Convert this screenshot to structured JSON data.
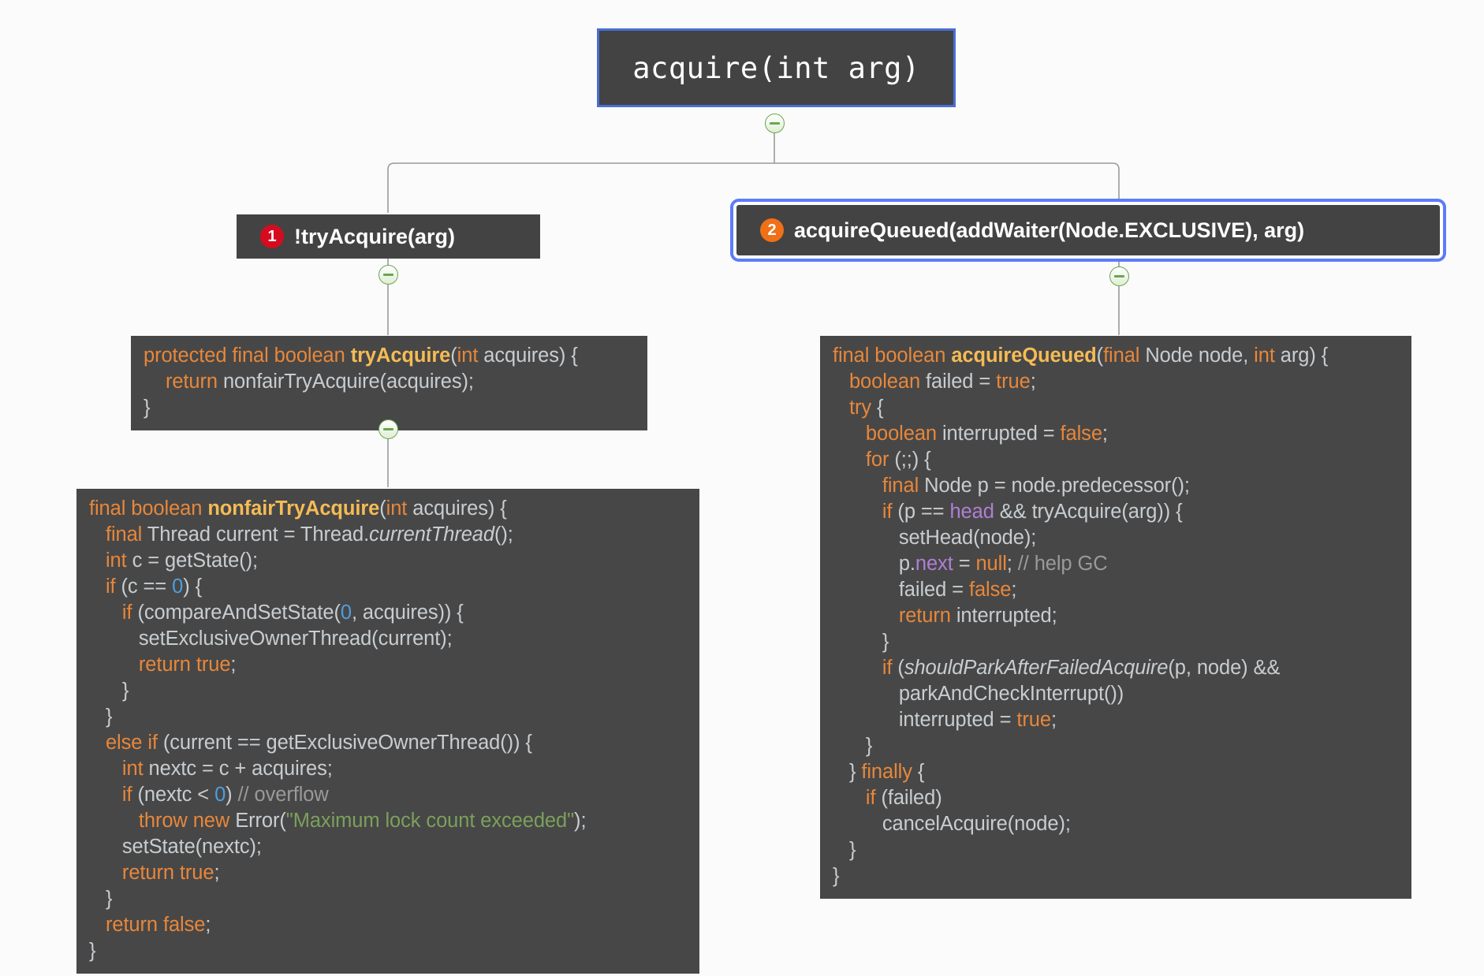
{
  "background_color": "#fbfbfb",
  "theme": {
    "node_bg": "#434343",
    "code_bg": "#474747",
    "selection_border": "#5b7cfa",
    "root_border": "#4a6fd4",
    "keyword_color": "#e8873a",
    "method_color": "#f5bb55",
    "number_color": "#4d9ede",
    "string_color": "#7ba05b",
    "comment_color": "#9a9a9a",
    "field_color": "#b07fd4",
    "badge_1_color": "#d50c1f",
    "badge_2_color": "#f07018",
    "toggle_color": "#6aa64f"
  },
  "root_node": {
    "label": "acquire(int arg)"
  },
  "branch_nodes": [
    {
      "badge": "1",
      "label": "!tryAcquire(arg)",
      "selected": false
    },
    {
      "badge": "2",
      "label": "acquireQueued(addWaiter(Node.EXCLUSIVE), arg)",
      "selected": true
    }
  ],
  "code_blocks": {
    "try_acquire": {
      "lines": [
        [
          {
            "t": "protected final boolean ",
            "c": "kw"
          },
          {
            "t": "tryAcquire",
            "c": "mth"
          },
          {
            "t": "(",
            "c": ""
          },
          {
            "t": "int",
            "c": "kw"
          },
          {
            "t": " acquires) {",
            "c": ""
          }
        ],
        [
          {
            "t": "    ",
            "c": ""
          },
          {
            "t": "return",
            "c": "kw"
          },
          {
            "t": " nonfairTryAcquire(acquires);",
            "c": ""
          }
        ],
        [
          {
            "t": "}",
            "c": ""
          }
        ]
      ],
      "plain_text": "protected final boolean tryAcquire(int acquires) {\n    return nonfairTryAcquire(acquires);\n}"
    },
    "nonfair_try_acquire": {
      "lines": [
        [
          {
            "t": "final boolean ",
            "c": "kw"
          },
          {
            "t": "nonfairTryAcquire",
            "c": "mth"
          },
          {
            "t": "(",
            "c": ""
          },
          {
            "t": "int",
            "c": "kw"
          },
          {
            "t": " acquires) {",
            "c": ""
          }
        ],
        [
          {
            "t": "   ",
            "c": ""
          },
          {
            "t": "final",
            "c": "kw"
          },
          {
            "t": " Thread current = Thread.",
            "c": ""
          },
          {
            "t": "currentThread",
            "c": "it"
          },
          {
            "t": "();",
            "c": ""
          }
        ],
        [
          {
            "t": "   ",
            "c": ""
          },
          {
            "t": "int",
            "c": "kw"
          },
          {
            "t": " c = getState();",
            "c": ""
          }
        ],
        [
          {
            "t": "   ",
            "c": ""
          },
          {
            "t": "if",
            "c": "kw"
          },
          {
            "t": " (c == ",
            "c": ""
          },
          {
            "t": "0",
            "c": "num"
          },
          {
            "t": ") {",
            "c": ""
          }
        ],
        [
          {
            "t": "      ",
            "c": ""
          },
          {
            "t": "if",
            "c": "kw"
          },
          {
            "t": " (compareAndSetState(",
            "c": ""
          },
          {
            "t": "0",
            "c": "num"
          },
          {
            "t": ", acquires)) {",
            "c": ""
          }
        ],
        [
          {
            "t": "         setExclusiveOwnerThread(current);",
            "c": ""
          }
        ],
        [
          {
            "t": "         ",
            "c": ""
          },
          {
            "t": "return true",
            "c": "kw"
          },
          {
            "t": ";",
            "c": ""
          }
        ],
        [
          {
            "t": "      }",
            "c": ""
          }
        ],
        [
          {
            "t": "   }",
            "c": ""
          }
        ],
        [
          {
            "t": "   ",
            "c": ""
          },
          {
            "t": "else if",
            "c": "kw"
          },
          {
            "t": " (current == getExclusiveOwnerThread()) {",
            "c": ""
          }
        ],
        [
          {
            "t": "      ",
            "c": ""
          },
          {
            "t": "int",
            "c": "kw"
          },
          {
            "t": " nextc = c + acquires;",
            "c": ""
          }
        ],
        [
          {
            "t": "      ",
            "c": ""
          },
          {
            "t": "if",
            "c": "kw"
          },
          {
            "t": " (nextc < ",
            "c": ""
          },
          {
            "t": "0",
            "c": "num"
          },
          {
            "t": ") ",
            "c": ""
          },
          {
            "t": "// overflow",
            "c": "cmt"
          }
        ],
        [
          {
            "t": "         ",
            "c": ""
          },
          {
            "t": "throw new",
            "c": "kw"
          },
          {
            "t": " Error(",
            "c": ""
          },
          {
            "t": "\"Maximum lock count exceeded\"",
            "c": "str"
          },
          {
            "t": ");",
            "c": ""
          }
        ],
        [
          {
            "t": "      setState(nextc);",
            "c": ""
          }
        ],
        [
          {
            "t": "      ",
            "c": ""
          },
          {
            "t": "return true",
            "c": "kw"
          },
          {
            "t": ";",
            "c": ""
          }
        ],
        [
          {
            "t": "   }",
            "c": ""
          }
        ],
        [
          {
            "t": "   ",
            "c": ""
          },
          {
            "t": "return false",
            "c": "kw"
          },
          {
            "t": ";",
            "c": ""
          }
        ],
        [
          {
            "t": "}",
            "c": ""
          }
        ]
      ],
      "plain_text": "final boolean nonfairTryAcquire(int acquires) {\n   final Thread current = Thread.currentThread();\n   int c = getState();\n   if (c == 0) {\n      if (compareAndSetState(0, acquires)) {\n         setExclusiveOwnerThread(current);\n         return true;\n      }\n   }\n   else if (current == getExclusiveOwnerThread()) {\n      int nextc = c + acquires;\n      if (nextc < 0) // overflow\n         throw new Error(\"Maximum lock count exceeded\");\n      setState(nextc);\n      return true;\n   }\n   return false;\n}"
    },
    "acquire_queued": {
      "lines": [
        [
          {
            "t": "final boolean ",
            "c": "kw"
          },
          {
            "t": "acquireQueued",
            "c": "mth"
          },
          {
            "t": "(",
            "c": ""
          },
          {
            "t": "final",
            "c": "kw"
          },
          {
            "t": " Node node, ",
            "c": ""
          },
          {
            "t": "int",
            "c": "kw"
          },
          {
            "t": " arg) {",
            "c": ""
          }
        ],
        [
          {
            "t": "   ",
            "c": ""
          },
          {
            "t": "boolean",
            "c": "kw"
          },
          {
            "t": " failed = ",
            "c": ""
          },
          {
            "t": "true",
            "c": "kw"
          },
          {
            "t": ";",
            "c": ""
          }
        ],
        [
          {
            "t": "   ",
            "c": ""
          },
          {
            "t": "try",
            "c": "kw"
          },
          {
            "t": " {",
            "c": ""
          }
        ],
        [
          {
            "t": "      ",
            "c": ""
          },
          {
            "t": "boolean",
            "c": "kw"
          },
          {
            "t": " interrupted = ",
            "c": ""
          },
          {
            "t": "false",
            "c": "kw"
          },
          {
            "t": ";",
            "c": ""
          }
        ],
        [
          {
            "t": "      ",
            "c": ""
          },
          {
            "t": "for",
            "c": "kw"
          },
          {
            "t": " (;;) {",
            "c": ""
          }
        ],
        [
          {
            "t": "         ",
            "c": ""
          },
          {
            "t": "final",
            "c": "kw"
          },
          {
            "t": " Node p = node.predecessor();",
            "c": ""
          }
        ],
        [
          {
            "t": "         ",
            "c": ""
          },
          {
            "t": "if",
            "c": "kw"
          },
          {
            "t": " (p == ",
            "c": ""
          },
          {
            "t": "head",
            "c": "fld"
          },
          {
            "t": " && tryAcquire(arg)) {",
            "c": ""
          }
        ],
        [
          {
            "t": "            setHead(node);",
            "c": ""
          }
        ],
        [
          {
            "t": "            p.",
            "c": ""
          },
          {
            "t": "next",
            "c": "fld"
          },
          {
            "t": " = ",
            "c": ""
          },
          {
            "t": "null",
            "c": "kw"
          },
          {
            "t": "; ",
            "c": ""
          },
          {
            "t": "// help GC",
            "c": "cmt"
          }
        ],
        [
          {
            "t": "            failed = ",
            "c": ""
          },
          {
            "t": "false",
            "c": "kw"
          },
          {
            "t": ";",
            "c": ""
          }
        ],
        [
          {
            "t": "            ",
            "c": ""
          },
          {
            "t": "return",
            "c": "kw"
          },
          {
            "t": " interrupted;",
            "c": ""
          }
        ],
        [
          {
            "t": "         }",
            "c": ""
          }
        ],
        [
          {
            "t": "         ",
            "c": ""
          },
          {
            "t": "if",
            "c": "kw"
          },
          {
            "t": " (",
            "c": ""
          },
          {
            "t": "shouldParkAfterFailedAcquire",
            "c": "it"
          },
          {
            "t": "(p, node) &&",
            "c": ""
          }
        ],
        [
          {
            "t": "            parkAndCheckInterrupt())",
            "c": ""
          }
        ],
        [
          {
            "t": "            interrupted = ",
            "c": ""
          },
          {
            "t": "true",
            "c": "kw"
          },
          {
            "t": ";",
            "c": ""
          }
        ],
        [
          {
            "t": "      }",
            "c": ""
          }
        ],
        [
          {
            "t": "   } ",
            "c": ""
          },
          {
            "t": "finally",
            "c": "kw"
          },
          {
            "t": " {",
            "c": ""
          }
        ],
        [
          {
            "t": "      ",
            "c": ""
          },
          {
            "t": "if",
            "c": "kw"
          },
          {
            "t": " (failed)",
            "c": ""
          }
        ],
        [
          {
            "t": "         cancelAcquire(node);",
            "c": ""
          }
        ],
        [
          {
            "t": "   }",
            "c": ""
          }
        ],
        [
          {
            "t": "}",
            "c": ""
          }
        ]
      ],
      "plain_text": "final boolean acquireQueued(final Node node, int arg) {\n   boolean failed = true;\n   try {\n      boolean interrupted = false;\n      for (;;) {\n         final Node p = node.predecessor();\n         if (p == head && tryAcquire(arg)) {\n            setHead(node);\n            p.next = null; // help GC\n            failed = false;\n            return interrupted;\n         }\n         if (shouldParkAfterFailedAcquire(p, node) &&\n            parkAndCheckInterrupt())\n            interrupted = true;\n      }\n   } finally {\n      if (failed)\n         cancelAcquire(node);\n   }\n}"
    }
  },
  "toggles": [
    {
      "id": "root-toggle",
      "state": "expanded",
      "glyph": "minus"
    },
    {
      "id": "try-acquire-toggle",
      "state": "expanded",
      "glyph": "minus"
    },
    {
      "id": "nonfair-toggle",
      "state": "expanded",
      "glyph": "minus"
    },
    {
      "id": "acquire-queued-toggle",
      "state": "expanded",
      "glyph": "minus"
    }
  ]
}
